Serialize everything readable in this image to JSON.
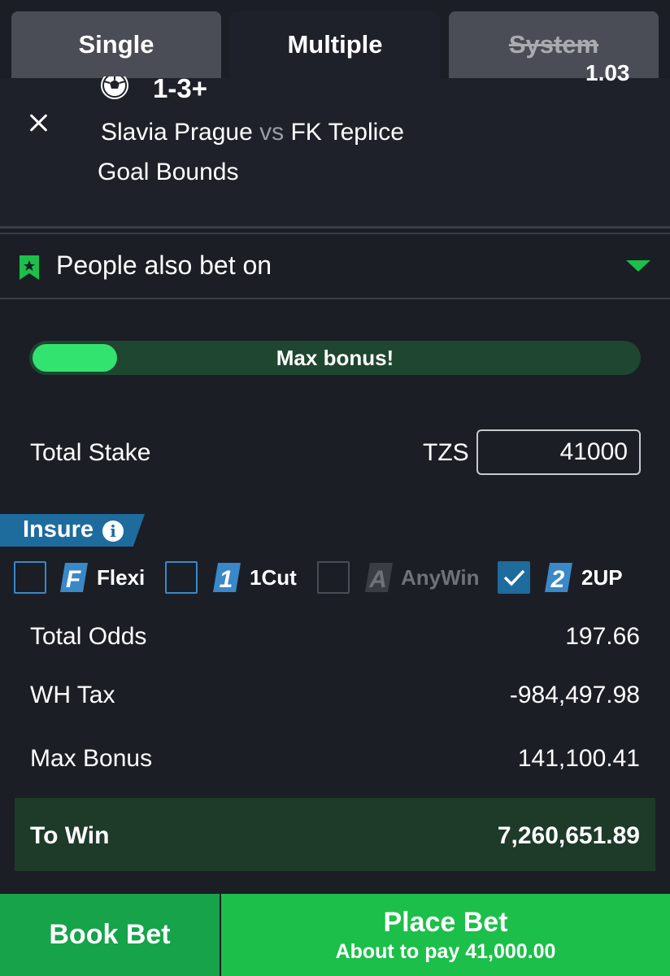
{
  "tabs": [
    {
      "label": "Single",
      "state": "inactive"
    },
    {
      "label": "Multiple",
      "state": "active"
    },
    {
      "label": "System",
      "state": "disabled"
    }
  ],
  "selection": {
    "pick": "1-3+",
    "home_team": "Slavia Prague",
    "vs": "vs",
    "away_team": "FK Teplice",
    "market": "Goal Bounds",
    "odds_partial": "1.03"
  },
  "people_also_bet": {
    "label": "People also bet on"
  },
  "bonus_progress": {
    "label": "Max bonus!",
    "fill_fraction": 0.14
  },
  "stake": {
    "label": "Total Stake",
    "currency": "TZS",
    "value": "41000"
  },
  "insure": {
    "label": "Insure",
    "info_glyph": "i",
    "options": [
      {
        "icon_glyph": "F",
        "label": "Flexi",
        "checked": false,
        "enabled": true
      },
      {
        "icon_glyph": "1",
        "label": "1Cut",
        "checked": false,
        "enabled": true
      },
      {
        "icon_glyph": "A",
        "label": "AnyWin",
        "checked": false,
        "enabled": false
      },
      {
        "icon_glyph": "2",
        "label": "2UP",
        "checked": true,
        "enabled": true
      }
    ]
  },
  "summary": {
    "total_odds_label": "Total Odds",
    "total_odds_value": "197.66",
    "wh_tax_label": "WH Tax",
    "wh_tax_value": "-984,497.98",
    "max_bonus_label": "Max Bonus",
    "max_bonus_value": "141,100.41",
    "to_win_label": "To Win",
    "to_win_value": "7,260,651.89"
  },
  "actions": {
    "book_bet": "Book Bet",
    "place_bet": "Place Bet",
    "place_bet_sub": "About to pay 41,000.00"
  },
  "colors": {
    "background": "#1b1e25",
    "accent_green": "#1bbf4a",
    "progress_fill": "#33e36f",
    "insure_blue": "#1e6b9e"
  }
}
